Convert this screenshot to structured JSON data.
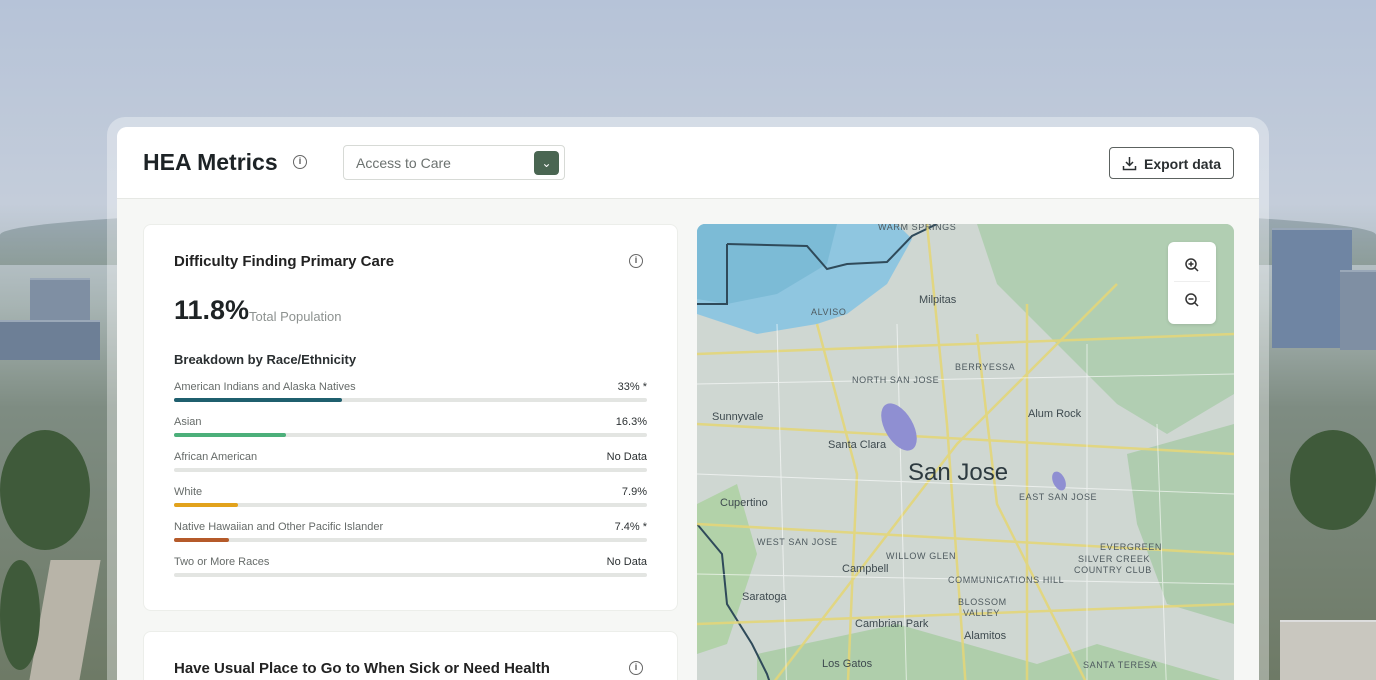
{
  "header": {
    "title": "HEA Metrics",
    "metric_select": {
      "value": "Access to Care"
    },
    "export_label": "Export data"
  },
  "card1": {
    "title": "Difficulty Finding Primary Care",
    "total_value": "11.8%",
    "total_label": "Total Population",
    "breakdown_title": "Breakdown by Race/Ethnicity",
    "rows": [
      {
        "name": "American Indians and Alaska Natives",
        "pct": "33% *",
        "fill": 0.355,
        "color": "#1f5f6e"
      },
      {
        "name": "Asian",
        "pct": "16.3%",
        "fill": 0.237,
        "color": "#4caf7a"
      },
      {
        "name": "African American",
        "pct": "No Data",
        "fill": 0,
        "color": "#cccccc"
      },
      {
        "name": "White",
        "pct": "7.9%",
        "fill": 0.135,
        "color": "#e2a21c"
      },
      {
        "name": "Native Hawaiian and Other Pacific Islander",
        "pct": "7.4% *",
        "fill": 0.117,
        "color": "#b55a2a"
      },
      {
        "name": "Two or More Races",
        "pct": "No Data",
        "fill": 0,
        "color": "#cccccc"
      }
    ]
  },
  "card2": {
    "title": "Have Usual Place to Go to When Sick or Need Health"
  },
  "map": {
    "labels": {
      "warm_springs": "WARM SPRINGS",
      "milpitas": "Milpitas",
      "alviso": "ALVISO",
      "berryessa": "BERRYESSA",
      "north_san_jose": "NORTH SAN JOSE",
      "sunnyvale": "Sunnyvale",
      "alum_rock": "Alum Rock",
      "santa_clara": "Santa Clara",
      "san_jose": "San Jose",
      "east_san_jose": "EAST SAN JOSE",
      "cupertino": "Cupertino",
      "west_san_jose": "WEST SAN JOSE",
      "willow_glen": "WILLOW GLEN",
      "evergreen": "EVERGREEN",
      "silver_creek": "SILVER CREEK",
      "country_club": "COUNTRY CLUB",
      "campbell": "Campbell",
      "communications_hill": "COMMUNICATIONS HILL",
      "saratoga": "Saratoga",
      "blossom": "BLOSSOM",
      "valley": "VALLEY",
      "cambrian_park": "Cambrian Park",
      "alamitos": "Alamitos",
      "los_gatos": "Los Gatos",
      "santa_teresa": "SANTA TERESA"
    }
  }
}
